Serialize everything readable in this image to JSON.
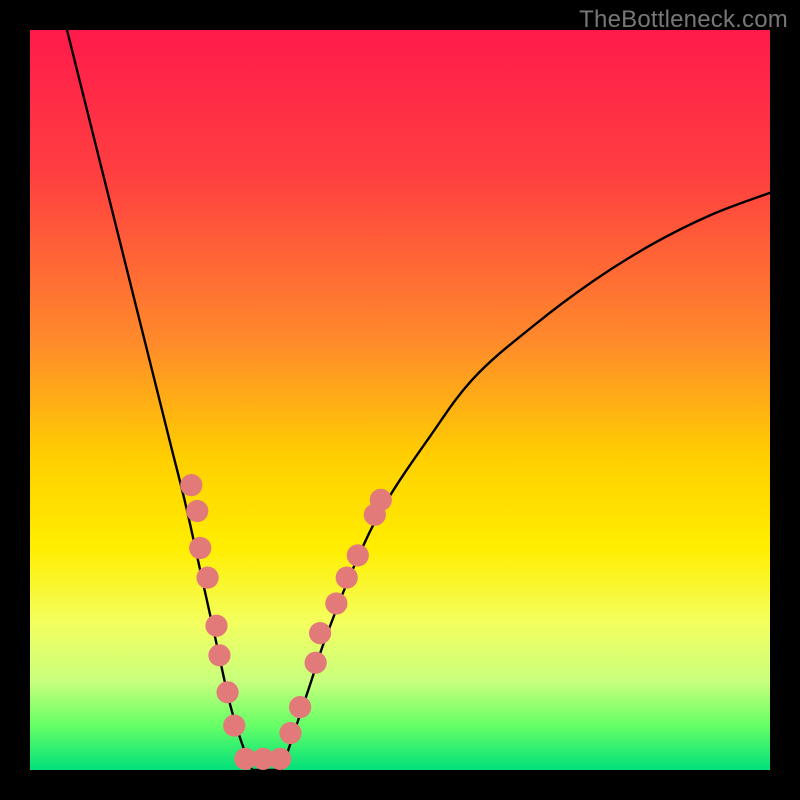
{
  "watermark": "TheBottleneck.com",
  "chart_data": {
    "type": "line",
    "title": "",
    "xlabel": "",
    "ylabel": "",
    "xlim": [
      0,
      100
    ],
    "ylim": [
      0,
      100
    ],
    "gradient_stops": [
      {
        "offset": 0,
        "color": "#ff1a4b"
      },
      {
        "offset": 20,
        "color": "#ff4040"
      },
      {
        "offset": 42,
        "color": "#ff8a2b"
      },
      {
        "offset": 58,
        "color": "#ffd000"
      },
      {
        "offset": 70,
        "color": "#ffee00"
      },
      {
        "offset": 80,
        "color": "#f4ff5e"
      },
      {
        "offset": 88,
        "color": "#c8ff7d"
      },
      {
        "offset": 94,
        "color": "#66ff66"
      },
      {
        "offset": 100,
        "color": "#00e07a"
      }
    ],
    "series": [
      {
        "name": "left_curve",
        "x": [
          5,
          7,
          9,
          11,
          13,
          15,
          17,
          19,
          21,
          23,
          25,
          27,
          28.5,
          30
        ],
        "y": [
          100,
          92,
          84,
          76,
          68,
          60,
          52,
          44,
          36,
          27,
          18,
          9,
          4,
          0
        ]
      },
      {
        "name": "right_curve",
        "x": [
          34,
          36,
          38,
          40,
          44,
          48,
          54,
          60,
          68,
          76,
          84,
          92,
          100
        ],
        "y": [
          0,
          6,
          12,
          18,
          28,
          36,
          45,
          53,
          60,
          66,
          71,
          75,
          78
        ]
      },
      {
        "name": "floor",
        "x": [
          30,
          34
        ],
        "y": [
          0,
          0
        ]
      }
    ],
    "markers": {
      "color": "#e37a7a",
      "radius_pct": 1.5,
      "points": [
        {
          "x": 21.8,
          "y": 38.5
        },
        {
          "x": 22.6,
          "y": 35.0
        },
        {
          "x": 23.0,
          "y": 30.0
        },
        {
          "x": 24.0,
          "y": 26.0
        },
        {
          "x": 25.2,
          "y": 19.5
        },
        {
          "x": 25.6,
          "y": 15.5
        },
        {
          "x": 26.7,
          "y": 10.5
        },
        {
          "x": 27.6,
          "y": 6.0
        },
        {
          "x": 29.1,
          "y": 1.5
        },
        {
          "x": 31.5,
          "y": 1.5
        },
        {
          "x": 33.8,
          "y": 1.5
        },
        {
          "x": 35.2,
          "y": 5.0
        },
        {
          "x": 36.5,
          "y": 8.5
        },
        {
          "x": 38.6,
          "y": 14.5
        },
        {
          "x": 39.2,
          "y": 18.5
        },
        {
          "x": 41.4,
          "y": 22.5
        },
        {
          "x": 42.8,
          "y": 26.0
        },
        {
          "x": 44.3,
          "y": 29.0
        },
        {
          "x": 46.6,
          "y": 34.5
        },
        {
          "x": 47.4,
          "y": 36.5
        }
      ]
    }
  }
}
